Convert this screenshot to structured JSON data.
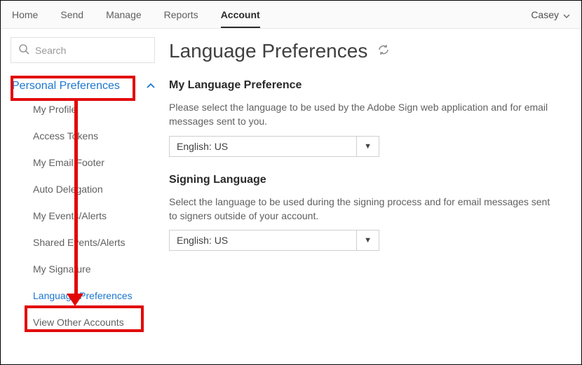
{
  "topnav": {
    "tabs": [
      "Home",
      "Send",
      "Manage",
      "Reports",
      "Account"
    ],
    "active_index": 4,
    "user_name": "Casey"
  },
  "sidebar": {
    "search_placeholder": "Search",
    "group_label": "Personal Preferences",
    "items": [
      "My Profile",
      "Access Tokens",
      "My Email Footer",
      "Auto Delegation",
      "My Events/Alerts",
      "Shared Events/Alerts",
      "My Signature",
      "Language Preferences",
      "View Other Accounts"
    ],
    "selected_index": 7
  },
  "page": {
    "title": "Language Preferences",
    "section1": {
      "heading": "My Language Preference",
      "desc": "Please select the language to be used by the Adobe Sign web application and for email messages sent to you.",
      "value": "English: US"
    },
    "section2": {
      "heading": "Signing Language",
      "desc": "Select the language to be used during the signing process and for email messages sent to signers outside of your account.",
      "value": "English: US"
    }
  },
  "annotations": {
    "highlight_group": true,
    "highlight_lang_item": true,
    "arrow": true
  }
}
